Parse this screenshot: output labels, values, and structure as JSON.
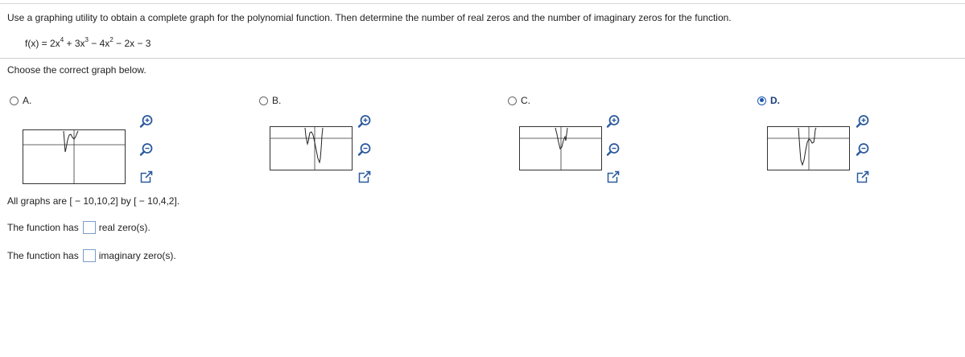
{
  "question": "Use a graphing utility to obtain a complete graph for the polynomial function. Then determine the number of real zeros and the number of imaginary zeros for the function.",
  "function": {
    "prefix": "f(x) = 2x",
    "e1": "4",
    "p2": " + 3x",
    "e2": "3",
    "p3": " − 4x",
    "e3": "2",
    "p4": " − 2x − 3"
  },
  "choose": "Choose the correct graph below.",
  "options": [
    {
      "label": "A.",
      "selected": false
    },
    {
      "label": "B.",
      "selected": false
    },
    {
      "label": "C.",
      "selected": false
    },
    {
      "label": "D.",
      "selected": true
    }
  ],
  "graph_window": {
    "xmin": -10,
    "xmax": 10,
    "xscl": 2,
    "ymin": -10,
    "ymax": 4,
    "yscl": 2
  },
  "all_graphs": "All graphs are [ − 10,10,2] by [ − 10,4,2].",
  "answer1": {
    "prefix": "The function has",
    "suffix": "real zero(s).",
    "value": ""
  },
  "answer2": {
    "prefix": "The function has",
    "suffix": "imaginary zero(s).",
    "value": ""
  },
  "colors": {
    "selected": "#1a56b0",
    "box_border": "#7a9cc6"
  }
}
